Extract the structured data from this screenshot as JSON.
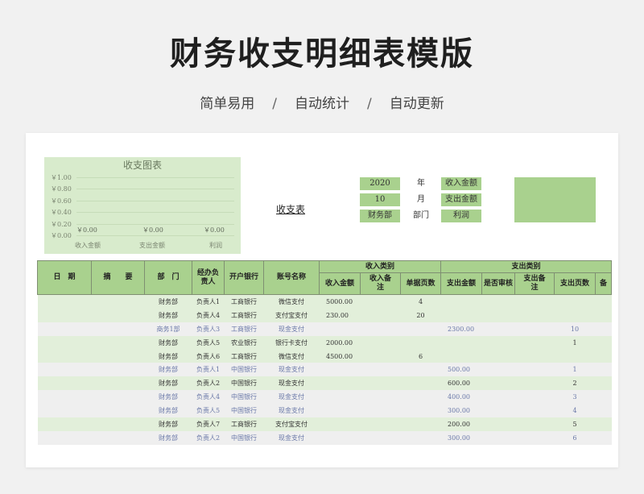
{
  "header": {
    "title": "财务收支明细表模版",
    "subtitle": [
      "简单易用",
      "自动统计",
      "自动更新"
    ],
    "separator": "/"
  },
  "chart_data": {
    "type": "bar",
    "title": "收支图表",
    "categories": [
      "收入金额",
      "支出金额",
      "利润"
    ],
    "values": [
      0,
      0,
      0
    ],
    "data_labels": [
      "￥0.00",
      "￥0.00",
      "￥0.00"
    ],
    "y_ticks": [
      "￥1.00",
      "￥0.80",
      "￥0.60",
      "￥0.40",
      "￥0.20",
      "￥0.00"
    ],
    "ylim": [
      0,
      1
    ],
    "grid": true
  },
  "summary": {
    "sheet_title": "收支表",
    "year_value": "2020",
    "year_label": "年",
    "month_value": "10",
    "month_label": "月",
    "dept_value": "财务部",
    "dept_label": "部门",
    "income_label": "收入金额",
    "expense_label": "支出金额",
    "profit_label": "利润"
  },
  "table": {
    "headers": {
      "date": "日　期",
      "summary": "摘　　要",
      "dept": "部　门",
      "handler": "经办负责人",
      "bank": "开户银行",
      "account": "账号名称",
      "income_group": "收入类别",
      "expense_group": "支出类别",
      "income_amount": "收入金额",
      "income_note": "收入备注",
      "income_pages": "单据页数",
      "expense_amount": "支出金额",
      "audited": "是否审核",
      "expense_note": "支出备注",
      "expense_pages": "支出页数",
      "remark": "备"
    },
    "rows": [
      {
        "dept": "财务部",
        "handler": "负责人1",
        "bank": "工商银行",
        "account": "微信支付",
        "income": "5000.00",
        "ipages": "4",
        "expense": "",
        "epages": ""
      },
      {
        "dept": "财务部",
        "handler": "负责人4",
        "bank": "工商银行",
        "account": "支付宝支付",
        "income": "230.00",
        "ipages": "20",
        "expense": "",
        "epages": ""
      },
      {
        "dept": "商务1部",
        "handler": "负责人3",
        "bank": "工商银行",
        "account": "现金支付",
        "income": "",
        "ipages": "",
        "expense": "2300.00",
        "epages": "10"
      },
      {
        "dept": "财务部",
        "handler": "负责人5",
        "bank": "农业银行",
        "account": "银行卡支付",
        "income": "2000.00",
        "ipages": "",
        "expense": "",
        "epages": "1"
      },
      {
        "dept": "财务部",
        "handler": "负责人6",
        "bank": "工商银行",
        "account": "微信支付",
        "income": "4500.00",
        "ipages": "6",
        "expense": "",
        "epages": ""
      },
      {
        "dept": "财务部",
        "handler": "负责人1",
        "bank": "中国银行",
        "account": "现金支付",
        "income": "",
        "ipages": "",
        "expense": "500.00",
        "epages": "1"
      },
      {
        "dept": "财务部",
        "handler": "负责人2",
        "bank": "中国银行",
        "account": "现金支付",
        "income": "",
        "ipages": "",
        "expense": "600.00",
        "epages": "2"
      },
      {
        "dept": "财务部",
        "handler": "负责人4",
        "bank": "中国银行",
        "account": "现金支付",
        "income": "",
        "ipages": "",
        "expense": "400.00",
        "epages": "3"
      },
      {
        "dept": "财务部",
        "handler": "负责人5",
        "bank": "中国银行",
        "account": "现金支付",
        "income": "",
        "ipages": "",
        "expense": "300.00",
        "epages": "4"
      },
      {
        "dept": "财务部",
        "handler": "负责人7",
        "bank": "工商银行",
        "account": "支付宝支付",
        "income": "",
        "ipages": "",
        "expense": "200.00",
        "epages": "5"
      },
      {
        "dept": "财务部",
        "handler": "负责人2",
        "bank": "中国银行",
        "account": "现金支付",
        "income": "",
        "ipages": "",
        "expense": "300.00",
        "epages": "6"
      }
    ]
  },
  "colors": {
    "accent_green": "#a9d18e",
    "row_green": "#e2efda",
    "row_gray": "#efefef",
    "blue_text": "#6a78a8"
  }
}
